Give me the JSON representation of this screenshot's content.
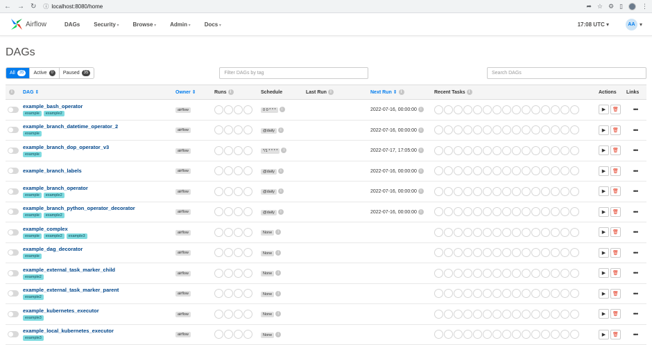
{
  "browser": {
    "url": "localhost:8080/home"
  },
  "nav": {
    "brand": "Airflow",
    "menu": [
      "DAGs",
      "Security",
      "Browse",
      "Admin",
      "Docs"
    ],
    "time": "17:08 UTC",
    "user_initials": "AA"
  },
  "page_title": "DAGs",
  "filters": {
    "all_label": "All",
    "all_count": "35",
    "active_label": "Active",
    "active_count": "0",
    "paused_label": "Paused",
    "paused_count": "35",
    "tag_placeholder": "Filter DAGs by tag",
    "search_placeholder": "Search DAGs"
  },
  "columns": {
    "dag": "DAG",
    "owner": "Owner",
    "runs": "Runs",
    "schedule": "Schedule",
    "last_run": "Last Run",
    "next_run": "Next Run",
    "recent_tasks": "Recent Tasks",
    "actions": "Actions",
    "links": "Links"
  },
  "rows": [
    {
      "name": "example_bash_operator",
      "tags": [
        "example",
        "example2"
      ],
      "owner": "airflow",
      "schedule": "0 0 * * *",
      "next_run": "2022-07-16, 00:00:00"
    },
    {
      "name": "example_branch_datetime_operator_2",
      "tags": [
        "example"
      ],
      "owner": "airflow",
      "schedule": "@daily",
      "next_run": "2022-07-16, 00:00:00"
    },
    {
      "name": "example_branch_dop_operator_v3",
      "tags": [
        "example"
      ],
      "owner": "airflow",
      "schedule": "*/1 * * * *",
      "next_run": "2022-07-17, 17:05:00"
    },
    {
      "name": "example_branch_labels",
      "tags": [],
      "owner": "airflow",
      "schedule": "@daily",
      "next_run": "2022-07-16, 00:00:00"
    },
    {
      "name": "example_branch_operator",
      "tags": [
        "example",
        "example2"
      ],
      "owner": "airflow",
      "schedule": "@daily",
      "next_run": "2022-07-16, 00:00:00"
    },
    {
      "name": "example_branch_python_operator_decorator",
      "tags": [
        "example",
        "example2"
      ],
      "owner": "airflow",
      "schedule": "@daily",
      "next_run": "2022-07-16, 00:00:00"
    },
    {
      "name": "example_complex",
      "tags": [
        "example",
        "example2",
        "example3"
      ],
      "owner": "airflow",
      "schedule": "None",
      "next_run": ""
    },
    {
      "name": "example_dag_decorator",
      "tags": [
        "example"
      ],
      "owner": "airflow",
      "schedule": "None",
      "next_run": ""
    },
    {
      "name": "example_external_task_marker_child",
      "tags": [
        "example2"
      ],
      "owner": "airflow",
      "schedule": "None",
      "next_run": ""
    },
    {
      "name": "example_external_task_marker_parent",
      "tags": [
        "example2"
      ],
      "owner": "airflow",
      "schedule": "None",
      "next_run": ""
    },
    {
      "name": "example_kubernetes_executor",
      "tags": [
        "example3"
      ],
      "owner": "airflow",
      "schedule": "None",
      "next_run": ""
    },
    {
      "name": "example_local_kubernetes_executor",
      "tags": [
        "example3"
      ],
      "owner": "airflow",
      "schedule": "None",
      "next_run": ""
    }
  ]
}
